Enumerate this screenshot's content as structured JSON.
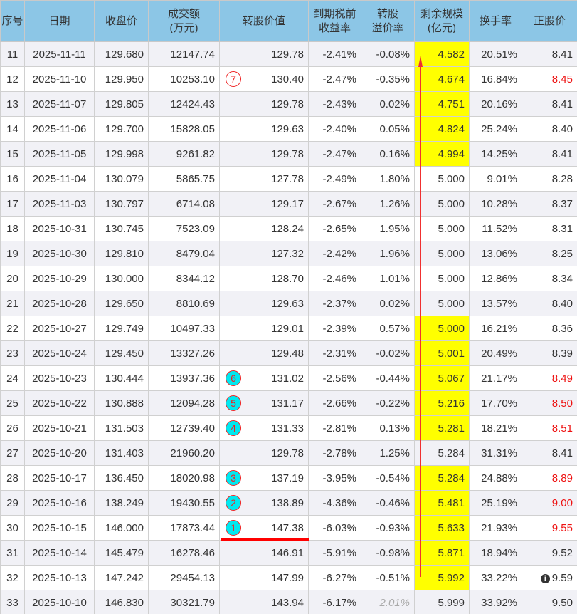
{
  "headers": [
    "序号",
    "日期",
    "收盘价",
    "成交额\n(万元)",
    "转股价值",
    "到期税前\n收益率",
    "转股\n溢价率",
    "剩余规模\n(亿元)",
    "换手率",
    "正股价"
  ],
  "rows": [
    [
      "11",
      "2025-11-11",
      "129.680",
      "12147.74",
      "129.78",
      "-2.41%",
      "-0.08%",
      "4.582",
      "20.51%",
      "8.41"
    ],
    [
      "12",
      "2025-11-10",
      "129.950",
      "10253.10",
      "130.40",
      "-2.47%",
      "-0.35%",
      "4.674",
      "16.84%",
      "8.45"
    ],
    [
      "13",
      "2025-11-07",
      "129.805",
      "12424.43",
      "129.78",
      "-2.43%",
      "0.02%",
      "4.751",
      "20.16%",
      "8.41"
    ],
    [
      "14",
      "2025-11-06",
      "129.700",
      "15828.05",
      "129.63",
      "-2.40%",
      "0.05%",
      "4.824",
      "25.24%",
      "8.40"
    ],
    [
      "15",
      "2025-11-05",
      "129.998",
      "9261.82",
      "129.78",
      "-2.47%",
      "0.16%",
      "4.994",
      "14.25%",
      "8.41"
    ],
    [
      "16",
      "2025-11-04",
      "130.079",
      "5865.75",
      "127.78",
      "-2.49%",
      "1.80%",
      "5.000",
      "9.01%",
      "8.28"
    ],
    [
      "17",
      "2025-11-03",
      "130.797",
      "6714.08",
      "129.17",
      "-2.67%",
      "1.26%",
      "5.000",
      "10.28%",
      "8.37"
    ],
    [
      "18",
      "2025-10-31",
      "130.745",
      "7523.09",
      "128.24",
      "-2.65%",
      "1.95%",
      "5.000",
      "11.52%",
      "8.31"
    ],
    [
      "19",
      "2025-10-30",
      "129.810",
      "8479.04",
      "127.32",
      "-2.42%",
      "1.96%",
      "5.000",
      "13.06%",
      "8.25"
    ],
    [
      "20",
      "2025-10-29",
      "130.000",
      "8344.12",
      "128.70",
      "-2.46%",
      "1.01%",
      "5.000",
      "12.86%",
      "8.34"
    ],
    [
      "21",
      "2025-10-28",
      "129.650",
      "8810.69",
      "129.63",
      "-2.37%",
      "0.02%",
      "5.000",
      "13.57%",
      "8.40"
    ],
    [
      "22",
      "2025-10-27",
      "129.749",
      "10497.33",
      "129.01",
      "-2.39%",
      "0.57%",
      "5.000",
      "16.21%",
      "8.36"
    ],
    [
      "23",
      "2025-10-24",
      "129.450",
      "13327.26",
      "129.48",
      "-2.31%",
      "-0.02%",
      "5.001",
      "20.49%",
      "8.39"
    ],
    [
      "24",
      "2025-10-23",
      "130.444",
      "13937.36",
      "131.02",
      "-2.56%",
      "-0.44%",
      "5.067",
      "21.17%",
      "8.49"
    ],
    [
      "25",
      "2025-10-22",
      "130.888",
      "12094.28",
      "131.17",
      "-2.66%",
      "-0.22%",
      "5.216",
      "17.70%",
      "8.50"
    ],
    [
      "26",
      "2025-10-21",
      "131.503",
      "12739.40",
      "131.33",
      "-2.81%",
      "0.13%",
      "5.281",
      "18.21%",
      "8.51"
    ],
    [
      "27",
      "2025-10-20",
      "131.403",
      "21960.20",
      "129.78",
      "-2.78%",
      "1.25%",
      "5.284",
      "31.31%",
      "8.41"
    ],
    [
      "28",
      "2025-10-17",
      "136.450",
      "18020.98",
      "137.19",
      "-3.95%",
      "-0.54%",
      "5.284",
      "24.88%",
      "8.89"
    ],
    [
      "29",
      "2025-10-16",
      "138.249",
      "19430.55",
      "138.89",
      "-4.36%",
      "-0.46%",
      "5.481",
      "25.19%",
      "9.00"
    ],
    [
      "30",
      "2025-10-15",
      "146.000",
      "17873.44",
      "147.38",
      "-6.03%",
      "-0.93%",
      "5.633",
      "21.93%",
      "9.55"
    ],
    [
      "31",
      "2025-10-14",
      "145.479",
      "16278.46",
      "146.91",
      "-5.91%",
      "-0.98%",
      "5.871",
      "18.94%",
      "9.52"
    ],
    [
      "32",
      "2025-10-13",
      "147.242",
      "29454.13",
      "147.99",
      "-6.27%",
      "-0.51%",
      "5.992",
      "33.22%",
      "9.59"
    ],
    [
      "33",
      "2025-10-10",
      "146.830",
      "30321.79",
      "143.94",
      "-6.17%",
      "2.01%",
      "5.999",
      "33.92%",
      "9.50"
    ]
  ],
  "highlight_rows": [
    "11",
    "12",
    "13",
    "14",
    "15",
    "22",
    "23",
    "24",
    "25",
    "26",
    "28",
    "29",
    "30",
    "31",
    "32"
  ],
  "red_price_rows": [
    "12",
    "24",
    "25",
    "26",
    "28",
    "29",
    "30"
  ],
  "markers": {
    "12": "7",
    "24": "6",
    "25": "5",
    "26": "4",
    "28": "3",
    "29": "2",
    "30": "1"
  },
  "info_row": "32",
  "info_icon": "i",
  "gray_premium_row": "33",
  "colors": {
    "header": "#8cc6e6",
    "highlight": "#ffff00",
    "red": "#ee1111",
    "marker_fill": "#00e8f0"
  }
}
